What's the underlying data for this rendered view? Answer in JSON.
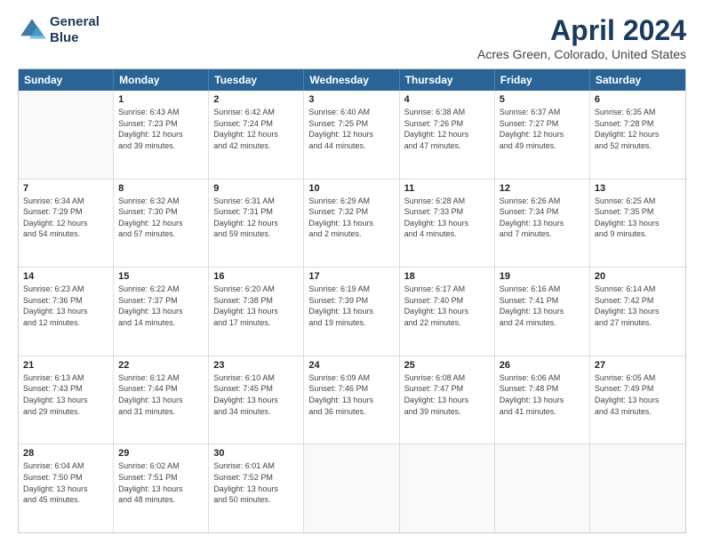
{
  "logo": {
    "line1": "General",
    "line2": "Blue"
  },
  "title": "April 2024",
  "subtitle": "Acres Green, Colorado, United States",
  "header_days": [
    "Sunday",
    "Monday",
    "Tuesday",
    "Wednesday",
    "Thursday",
    "Friday",
    "Saturday"
  ],
  "rows": [
    [
      {
        "day": "",
        "lines": []
      },
      {
        "day": "1",
        "lines": [
          "Sunrise: 6:43 AM",
          "Sunset: 7:23 PM",
          "Daylight: 12 hours",
          "and 39 minutes."
        ]
      },
      {
        "day": "2",
        "lines": [
          "Sunrise: 6:42 AM",
          "Sunset: 7:24 PM",
          "Daylight: 12 hours",
          "and 42 minutes."
        ]
      },
      {
        "day": "3",
        "lines": [
          "Sunrise: 6:40 AM",
          "Sunset: 7:25 PM",
          "Daylight: 12 hours",
          "and 44 minutes."
        ]
      },
      {
        "day": "4",
        "lines": [
          "Sunrise: 6:38 AM",
          "Sunset: 7:26 PM",
          "Daylight: 12 hours",
          "and 47 minutes."
        ]
      },
      {
        "day": "5",
        "lines": [
          "Sunrise: 6:37 AM",
          "Sunset: 7:27 PM",
          "Daylight: 12 hours",
          "and 49 minutes."
        ]
      },
      {
        "day": "6",
        "lines": [
          "Sunrise: 6:35 AM",
          "Sunset: 7:28 PM",
          "Daylight: 12 hours",
          "and 52 minutes."
        ]
      }
    ],
    [
      {
        "day": "7",
        "lines": [
          "Sunrise: 6:34 AM",
          "Sunset: 7:29 PM",
          "Daylight: 12 hours",
          "and 54 minutes."
        ]
      },
      {
        "day": "8",
        "lines": [
          "Sunrise: 6:32 AM",
          "Sunset: 7:30 PM",
          "Daylight: 12 hours",
          "and 57 minutes."
        ]
      },
      {
        "day": "9",
        "lines": [
          "Sunrise: 6:31 AM",
          "Sunset: 7:31 PM",
          "Daylight: 12 hours",
          "and 59 minutes."
        ]
      },
      {
        "day": "10",
        "lines": [
          "Sunrise: 6:29 AM",
          "Sunset: 7:32 PM",
          "Daylight: 13 hours",
          "and 2 minutes."
        ]
      },
      {
        "day": "11",
        "lines": [
          "Sunrise: 6:28 AM",
          "Sunset: 7:33 PM",
          "Daylight: 13 hours",
          "and 4 minutes."
        ]
      },
      {
        "day": "12",
        "lines": [
          "Sunrise: 6:26 AM",
          "Sunset: 7:34 PM",
          "Daylight: 13 hours",
          "and 7 minutes."
        ]
      },
      {
        "day": "13",
        "lines": [
          "Sunrise: 6:25 AM",
          "Sunset: 7:35 PM",
          "Daylight: 13 hours",
          "and 9 minutes."
        ]
      }
    ],
    [
      {
        "day": "14",
        "lines": [
          "Sunrise: 6:23 AM",
          "Sunset: 7:36 PM",
          "Daylight: 13 hours",
          "and 12 minutes."
        ]
      },
      {
        "day": "15",
        "lines": [
          "Sunrise: 6:22 AM",
          "Sunset: 7:37 PM",
          "Daylight: 13 hours",
          "and 14 minutes."
        ]
      },
      {
        "day": "16",
        "lines": [
          "Sunrise: 6:20 AM",
          "Sunset: 7:38 PM",
          "Daylight: 13 hours",
          "and 17 minutes."
        ]
      },
      {
        "day": "17",
        "lines": [
          "Sunrise: 6:19 AM",
          "Sunset: 7:39 PM",
          "Daylight: 13 hours",
          "and 19 minutes."
        ]
      },
      {
        "day": "18",
        "lines": [
          "Sunrise: 6:17 AM",
          "Sunset: 7:40 PM",
          "Daylight: 13 hours",
          "and 22 minutes."
        ]
      },
      {
        "day": "19",
        "lines": [
          "Sunrise: 6:16 AM",
          "Sunset: 7:41 PM",
          "Daylight: 13 hours",
          "and 24 minutes."
        ]
      },
      {
        "day": "20",
        "lines": [
          "Sunrise: 6:14 AM",
          "Sunset: 7:42 PM",
          "Daylight: 13 hours",
          "and 27 minutes."
        ]
      }
    ],
    [
      {
        "day": "21",
        "lines": [
          "Sunrise: 6:13 AM",
          "Sunset: 7:43 PM",
          "Daylight: 13 hours",
          "and 29 minutes."
        ]
      },
      {
        "day": "22",
        "lines": [
          "Sunrise: 6:12 AM",
          "Sunset: 7:44 PM",
          "Daylight: 13 hours",
          "and 31 minutes."
        ]
      },
      {
        "day": "23",
        "lines": [
          "Sunrise: 6:10 AM",
          "Sunset: 7:45 PM",
          "Daylight: 13 hours",
          "and 34 minutes."
        ]
      },
      {
        "day": "24",
        "lines": [
          "Sunrise: 6:09 AM",
          "Sunset: 7:46 PM",
          "Daylight: 13 hours",
          "and 36 minutes."
        ]
      },
      {
        "day": "25",
        "lines": [
          "Sunrise: 6:08 AM",
          "Sunset: 7:47 PM",
          "Daylight: 13 hours",
          "and 39 minutes."
        ]
      },
      {
        "day": "26",
        "lines": [
          "Sunrise: 6:06 AM",
          "Sunset: 7:48 PM",
          "Daylight: 13 hours",
          "and 41 minutes."
        ]
      },
      {
        "day": "27",
        "lines": [
          "Sunrise: 6:05 AM",
          "Sunset: 7:49 PM",
          "Daylight: 13 hours",
          "and 43 minutes."
        ]
      }
    ],
    [
      {
        "day": "28",
        "lines": [
          "Sunrise: 6:04 AM",
          "Sunset: 7:50 PM",
          "Daylight: 13 hours",
          "and 45 minutes."
        ]
      },
      {
        "day": "29",
        "lines": [
          "Sunrise: 6:02 AM",
          "Sunset: 7:51 PM",
          "Daylight: 13 hours",
          "and 48 minutes."
        ]
      },
      {
        "day": "30",
        "lines": [
          "Sunrise: 6:01 AM",
          "Sunset: 7:52 PM",
          "Daylight: 13 hours",
          "and 50 minutes."
        ]
      },
      {
        "day": "",
        "lines": []
      },
      {
        "day": "",
        "lines": []
      },
      {
        "day": "",
        "lines": []
      },
      {
        "day": "",
        "lines": []
      }
    ]
  ]
}
